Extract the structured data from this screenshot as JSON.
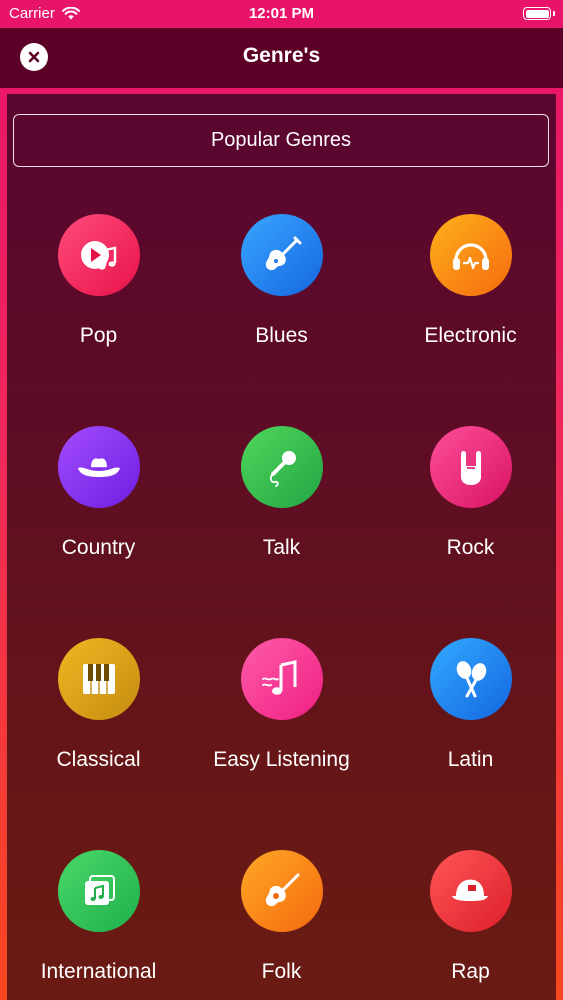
{
  "status_bar": {
    "carrier": "Carrier",
    "time": "12:01 PM"
  },
  "nav": {
    "title": "Genre's"
  },
  "popular_button": "Popular Genres",
  "genres": [
    {
      "label": "Pop",
      "icon": "play-music-note-icon",
      "color": "#f0285a"
    },
    {
      "label": "Blues",
      "icon": "electric-guitar-icon",
      "color": "#1e7cf0"
    },
    {
      "label": "Electronic",
      "icon": "headphones-icon",
      "color": "#f78c12"
    },
    {
      "label": "Country",
      "icon": "cowboy-hat-icon",
      "color": "#8a30f0"
    },
    {
      "label": "Talk",
      "icon": "microphone-icon",
      "color": "#30bd4e"
    },
    {
      "label": "Rock",
      "icon": "rock-hand-icon",
      "color": "#ea2a7e"
    },
    {
      "label": "Classical",
      "icon": "piano-keys-icon",
      "color": "#dba11a"
    },
    {
      "label": "Easy Listening",
      "icon": "music-note-waves-icon",
      "color": "#f73e96"
    },
    {
      "label": "Latin",
      "icon": "maracas-icon",
      "color": "#1e86f0"
    },
    {
      "label": "International",
      "icon": "music-album-icon",
      "color": "#32c45a"
    },
    {
      "label": "Folk",
      "icon": "acoustic-guitar-icon",
      "color": "#f88a1a"
    },
    {
      "label": "Rap",
      "icon": "cap-icon",
      "color": "#ea3038"
    }
  ]
}
